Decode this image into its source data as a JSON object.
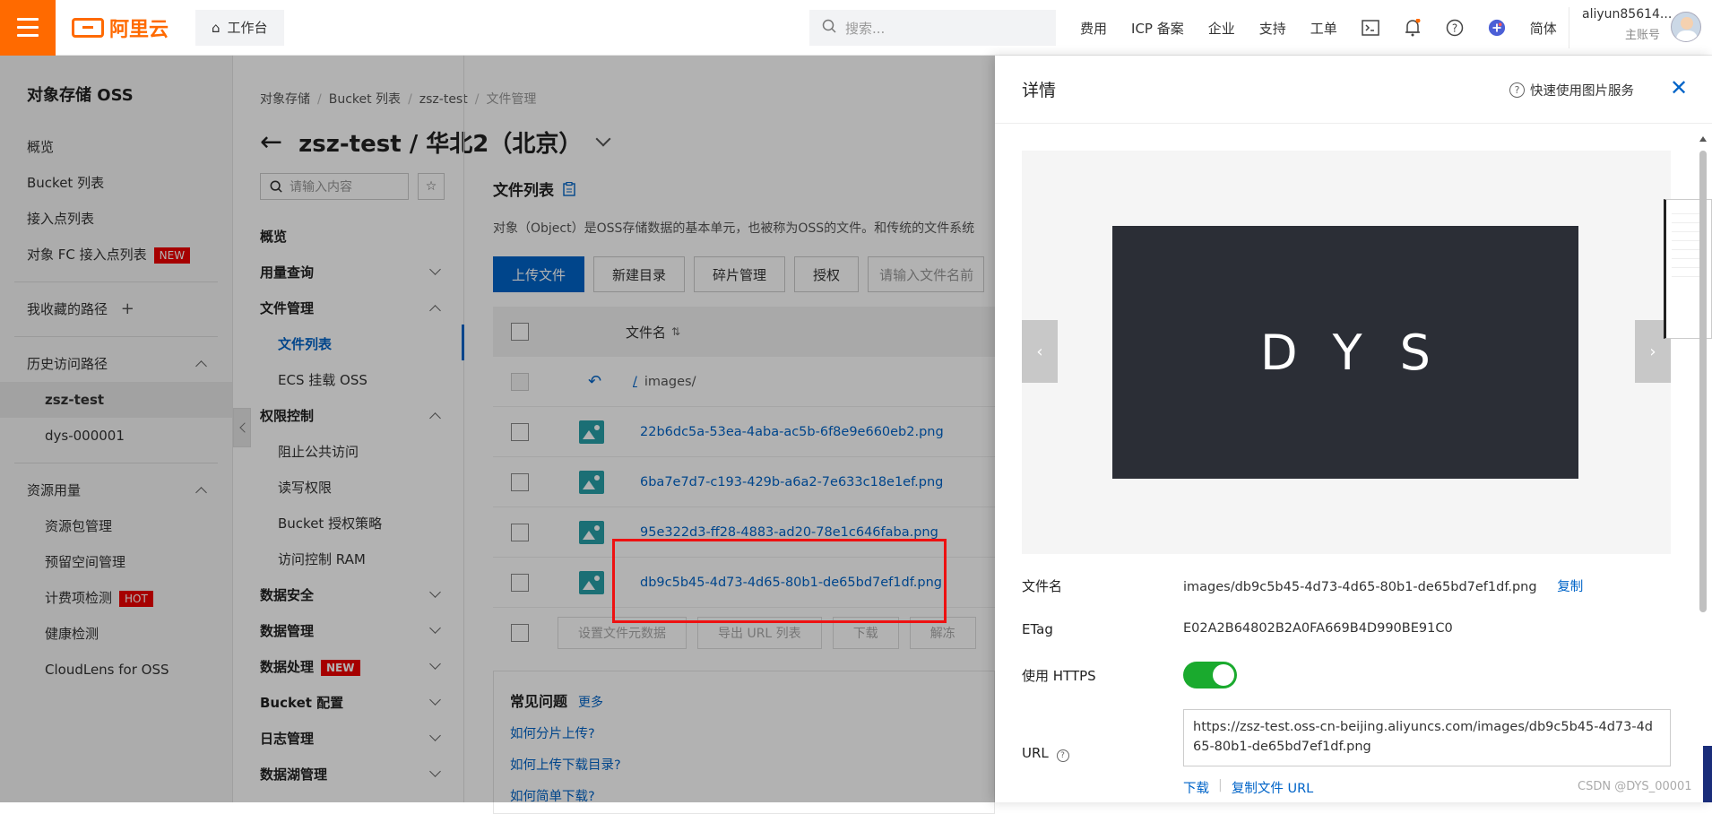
{
  "topbar": {
    "logo_text": "阿里云",
    "workbench_label": "工作台",
    "search_placeholder": "搜索...",
    "nav": [
      "费用",
      "ICP 备案",
      "企业",
      "支持",
      "工单"
    ],
    "lang": "简体",
    "user_name": "aliyun85614...",
    "user_role": "主账号",
    "accent_color": "#ff6a00"
  },
  "left_sidebar": {
    "title": "对象存储 OSS",
    "items": [
      {
        "label": "概览"
      },
      {
        "label": "Bucket 列表"
      },
      {
        "label": "接入点列表"
      },
      {
        "label": "对象 FC 接入点列表",
        "badge": "NEW"
      }
    ],
    "favorites_label": "我收藏的路径",
    "history_label": "历史访问路径",
    "history_items": [
      "zsz-test",
      "dys-000001"
    ],
    "resource_label": "资源用量",
    "resource_items": [
      {
        "label": "资源包管理"
      },
      {
        "label": "预留空间管理"
      },
      {
        "label": "计费项检测",
        "badge": "HOT"
      },
      {
        "label": "健康检测"
      },
      {
        "label": "CloudLens for OSS"
      }
    ]
  },
  "breadcrumb": [
    "对象存储",
    "Bucket 列表",
    "zsz-test",
    "文件管理"
  ],
  "page_title": "zsz-test / 华北2（北京）",
  "mid_search_placeholder": "请输入内容",
  "mid_nav": [
    {
      "label": "概览",
      "type": "group"
    },
    {
      "label": "用量查询",
      "type": "group",
      "chev": "down"
    },
    {
      "label": "文件管理",
      "type": "group",
      "chev": "up"
    },
    {
      "label": "文件列表",
      "type": "sub",
      "active": true
    },
    {
      "label": "ECS 挂载 OSS",
      "type": "sub"
    },
    {
      "label": "权限控制",
      "type": "group",
      "chev": "up"
    },
    {
      "label": "阻止公共访问",
      "type": "sub"
    },
    {
      "label": "读写权限",
      "type": "sub"
    },
    {
      "label": "Bucket 授权策略",
      "type": "sub"
    },
    {
      "label": "访问控制 RAM",
      "type": "sub"
    },
    {
      "label": "数据安全",
      "type": "group",
      "chev": "down"
    },
    {
      "label": "数据管理",
      "type": "group",
      "chev": "down"
    },
    {
      "label": "数据处理",
      "type": "group",
      "chev": "down",
      "badge": "NEW"
    },
    {
      "label": "Bucket 配置",
      "type": "group",
      "chev": "down"
    },
    {
      "label": "日志管理",
      "type": "group",
      "chev": "down"
    },
    {
      "label": "数据湖管理",
      "type": "group",
      "chev": "down"
    }
  ],
  "file_list": {
    "title": "文件列表",
    "description": "对象（Object）是OSS存储数据的基本单元，也被称为OSS的文件。和传统的文件系统",
    "toolbar": [
      "上传文件",
      "新建目录",
      "碎片管理",
      "授权"
    ],
    "filter_placeholder": "请输入文件名前",
    "column_name": "文件名",
    "parent_path_prefix": "/",
    "parent_path": "images/",
    "files": [
      "22b6dc5a-53ea-4aba-ac5b-6f8e9e660eb2.png",
      "6ba7e7d7-c193-429b-a6a2-7e633c18e1ef.png",
      "95e322d3-ff28-4883-ad20-78e1c646faba.png",
      "db9c5b45-4d73-4d65-80b1-de65bd7ef1df.png"
    ],
    "bulk_actions": [
      "设置文件元数据",
      "导出 URL 列表",
      "下载",
      "解冻"
    ]
  },
  "faq": {
    "title": "常见问题",
    "more": "更多",
    "items": [
      "如何分片上传?",
      "如何上传下载目录?",
      "如何简单下载?"
    ]
  },
  "detail": {
    "title": "详情",
    "quick_link": "快速使用图片服务",
    "preview_text": "DYS",
    "labels": {
      "filename": "文件名",
      "etag": "ETag",
      "https": "使用 HTTPS",
      "url": "URL"
    },
    "filename": "images/db9c5b45-4d73-4d65-80b1-de65bd7ef1df.png",
    "copy_label": "复制",
    "etag": "E02A2B64802B2A0FA669B4D990BE91C0",
    "https_enabled": true,
    "url": "https://zsz-test.oss-cn-beijing.aliyuncs.com/images/db9c5b45-4d73-4d65-80b1-de65bd7ef1df.png",
    "download_label": "下载",
    "copy_url_label": "复制文件 URL"
  },
  "watermark": "CSDN @DYS_00001"
}
